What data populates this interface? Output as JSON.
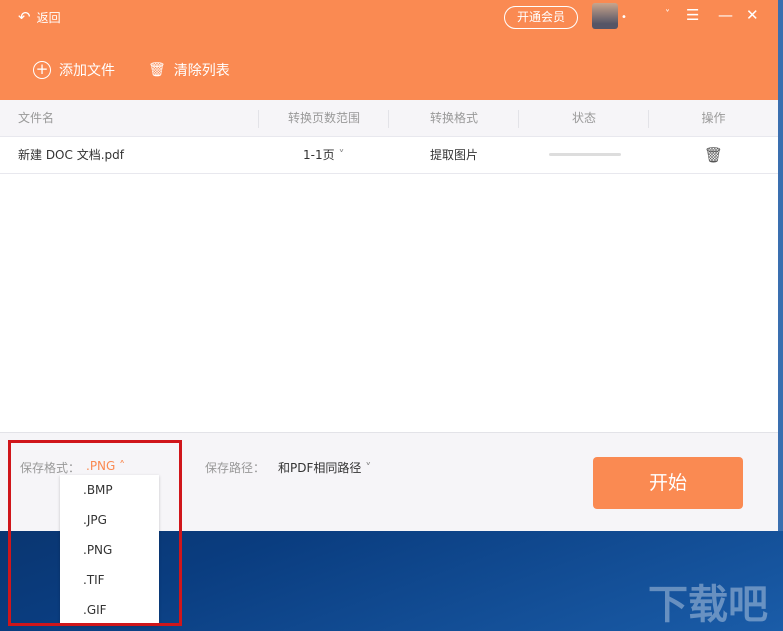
{
  "header": {
    "back": "返回",
    "vip": "开通会员",
    "add_file": "添加文件",
    "clear_list": "清除列表"
  },
  "table": {
    "columns": [
      "文件名",
      "转换页数范围",
      "转换格式",
      "状态",
      "操作"
    ],
    "rows": [
      {
        "name": "新建 DOC 文档.pdf",
        "range": "1-1页",
        "format": "提取图片",
        "progress": 0
      }
    ]
  },
  "footer": {
    "format_label": "保存格式：",
    "format_value": ".PNG",
    "path_label": "保存路径：",
    "path_value": "和PDF相同路径",
    "start": "开始"
  },
  "dropdown": {
    "options": [
      ".BMP",
      ".JPG",
      ".PNG",
      ".TIF",
      ".GIF"
    ]
  },
  "watermark": "下载吧",
  "colors": {
    "accent": "#fa8a52",
    "highlight": "#d0161b"
  }
}
